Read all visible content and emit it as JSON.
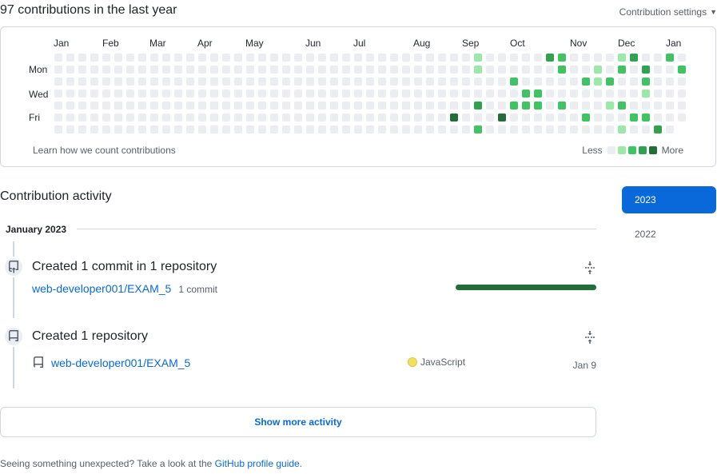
{
  "summary": {
    "heading": "97 contributions in the last year",
    "settings_label": "Contribution settings"
  },
  "calendar": {
    "months": [
      "Jan",
      "Feb",
      "Mar",
      "Apr",
      "May",
      "Jun",
      "Jul",
      "Aug",
      "Sep",
      "Oct",
      "Nov",
      "Dec",
      "Jan"
    ],
    "day_labels": [
      "Mon",
      "Wed",
      "Fri"
    ],
    "learn_link": "Learn how we count contributions",
    "legend_less": "Less",
    "legend_more": "More",
    "level_colors": [
      "#ebedf0",
      "#9be9a8",
      "#40c463",
      "#30a14e",
      "#216e39"
    ],
    "active_weeks": [
      {
        "week": 34,
        "levels": [
          0,
          0,
          0,
          0,
          0,
          4,
          0
        ]
      },
      {
        "week": 35,
        "levels": [
          0,
          0,
          0,
          0,
          0,
          0,
          0
        ]
      },
      {
        "week": 36,
        "levels": [
          1,
          1,
          0,
          0,
          3,
          0,
          2
        ]
      },
      {
        "week": 38,
        "levels": [
          0,
          0,
          0,
          0,
          0,
          4,
          0
        ]
      },
      {
        "week": 39,
        "levels": [
          0,
          0,
          2,
          0,
          2,
          0,
          0
        ]
      },
      {
        "week": 40,
        "levels": [
          0,
          0,
          0,
          2,
          2,
          0,
          0
        ]
      },
      {
        "week": 41,
        "levels": [
          0,
          0,
          0,
          2,
          2,
          0,
          0
        ]
      },
      {
        "week": 42,
        "levels": [
          3,
          0,
          0,
          0,
          0,
          0,
          0
        ]
      },
      {
        "week": 43,
        "levels": [
          2,
          2,
          0,
          0,
          2,
          0,
          0
        ]
      },
      {
        "week": 44,
        "levels": [
          0,
          0,
          0,
          0,
          0,
          0,
          0
        ]
      },
      {
        "week": 45,
        "levels": [
          0,
          0,
          2,
          0,
          0,
          2,
          0
        ]
      },
      {
        "week": 46,
        "levels": [
          0,
          1,
          1,
          0,
          0,
          0,
          0
        ]
      },
      {
        "week": 47,
        "levels": [
          0,
          0,
          2,
          0,
          1,
          0,
          0
        ]
      },
      {
        "week": 48,
        "levels": [
          1,
          2,
          0,
          0,
          2,
          0,
          1
        ]
      },
      {
        "week": 49,
        "levels": [
          3,
          0,
          0,
          0,
          0,
          2,
          0
        ]
      },
      {
        "week": 50,
        "levels": [
          0,
          3,
          2,
          1,
          0,
          2,
          0
        ]
      },
      {
        "week": 51,
        "levels": [
          0,
          0,
          0,
          0,
          0,
          0,
          3
        ]
      },
      {
        "week": 52,
        "levels": [
          2,
          0,
          0,
          0,
          0,
          0,
          0
        ]
      },
      {
        "week": 53,
        "levels": [
          0,
          2,
          0,
          0,
          0,
          0,
          0
        ]
      }
    ]
  },
  "activity": {
    "title": "Contribution activity",
    "years": [
      "2023",
      "2022"
    ],
    "month": "January 2023",
    "items": [
      {
        "title": "Created 1 commit in 1 repository",
        "repo": "web-developer001/EXAM_5",
        "meta": "1 commit",
        "commit_share_percent": 100
      },
      {
        "title": "Created 1 repository",
        "repo": "web-developer001/EXAM_5",
        "language": "JavaScript",
        "language_color": "#f1e05a",
        "date": "Jan 9"
      }
    ],
    "show_more_label": "Show more activity"
  },
  "footer": {
    "text": "Seeing something unexpected? Take a look at the",
    "link": "GitHub profile guide",
    "end": "."
  }
}
